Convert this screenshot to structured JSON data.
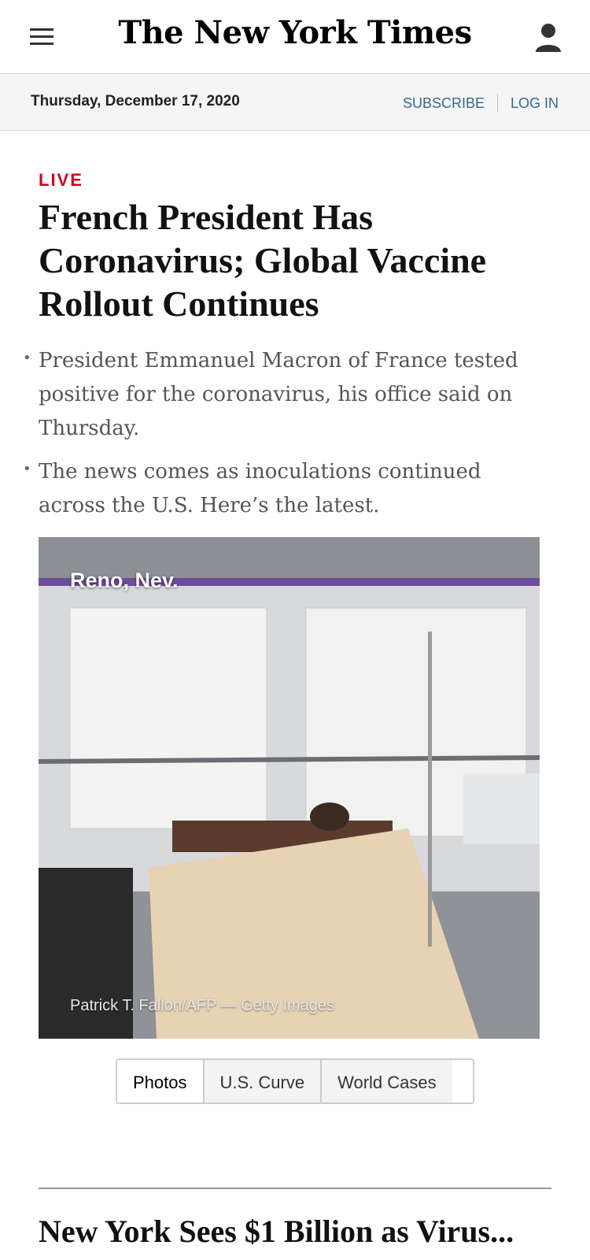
{
  "header": {
    "masthead": "The New York Times",
    "date": "Thursday, December 17, 2020",
    "subscribe_label": "SUBSCRIBE",
    "login_label": "LOG IN"
  },
  "article": {
    "live_label": "LIVE",
    "headline": "French President Has Coronavirus; Global Vaccine Rollout Continues",
    "summary": [
      "President Emmanuel Macron of France tested positive for the coronavirus, his office said on Thursday.",
      "The news comes as inoculations continued across the U.S. Here’s the latest."
    ],
    "photo": {
      "location": "Reno, Nev.",
      "credit": "Patrick T. Fallon/AFP — Getty Images"
    },
    "tabs": [
      "Photos",
      "U.S. Curve",
      "World Cases"
    ],
    "active_tab": "Photos"
  },
  "next_article": {
    "headline": "New York Sees $1 Billion as Virus..."
  },
  "colors": {
    "accent_link": "#326891",
    "live_red": "#d0021b"
  }
}
